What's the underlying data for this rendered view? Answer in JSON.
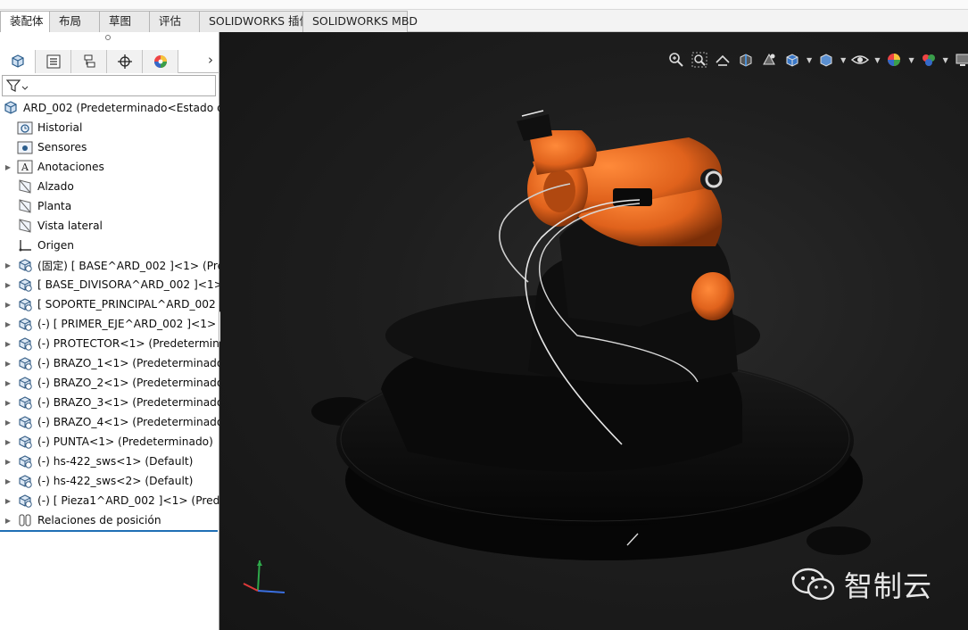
{
  "tabs": [
    {
      "label": "装配体",
      "active": true
    },
    {
      "label": "布局"
    },
    {
      "label": "草图"
    },
    {
      "label": "评估"
    },
    {
      "label": "SOLIDWORKS 插件"
    },
    {
      "label": "SOLIDWORKS MBD"
    }
  ],
  "tree": {
    "root": "ARD_002  (Predeterminado<Estado d",
    "items": [
      {
        "label": "Historial",
        "icon": "history-folder-icon",
        "expandable": false
      },
      {
        "label": "Sensores",
        "icon": "sensor-folder-icon",
        "expandable": false
      },
      {
        "label": "Anotaciones",
        "icon": "annotations-icon",
        "expandable": true
      },
      {
        "label": "Alzado",
        "icon": "plane-icon",
        "expandable": false
      },
      {
        "label": "Planta",
        "icon": "plane-icon",
        "expandable": false
      },
      {
        "label": "Vista lateral",
        "icon": "plane-icon",
        "expandable": false
      },
      {
        "label": "Origen",
        "icon": "origin-icon",
        "expandable": false
      },
      {
        "label": "(固定) [ BASE^ARD_002 ]<1> (Pre",
        "icon": "part-icon",
        "expandable": true
      },
      {
        "label": "[ BASE_DIVISORA^ARD_002 ]<1>",
        "icon": "part-icon",
        "expandable": true
      },
      {
        "label": "[ SOPORTE_PRINCIPAL^ARD_002 ]",
        "icon": "part-icon",
        "expandable": true
      },
      {
        "label": "(-) [ PRIMER_EJE^ARD_002 ]<1> (",
        "icon": "part-icon",
        "expandable": true
      },
      {
        "label": "(-) PROTECTOR<1> (Predetermina",
        "icon": "part-icon",
        "expandable": true
      },
      {
        "label": "(-) BRAZO_1<1> (Predeterminado",
        "icon": "part-icon",
        "expandable": true
      },
      {
        "label": "(-) BRAZO_2<1> (Predeterminado",
        "icon": "part-icon",
        "expandable": true
      },
      {
        "label": "(-) BRAZO_3<1> (Predeterminado",
        "icon": "part-icon",
        "expandable": true
      },
      {
        "label": "(-) BRAZO_4<1> (Predeterminado",
        "icon": "part-icon",
        "expandable": true
      },
      {
        "label": "(-) PUNTA<1> (Predeterminado)",
        "icon": "part-icon",
        "expandable": true
      },
      {
        "label": "(-) hs-422_sws<1> (Default)",
        "icon": "part-icon",
        "expandable": true
      },
      {
        "label": "(-) hs-422_sws<2> (Default)",
        "icon": "part-icon",
        "expandable": true
      },
      {
        "label": "(-) [ Pieza1^ARD_002 ]<1> (Prede",
        "icon": "part-icon",
        "expandable": true
      },
      {
        "label": "Relaciones de posición",
        "icon": "mates-icon",
        "expandable": true
      }
    ]
  },
  "watermark": "智制云",
  "colors": {
    "robot": "#e0621c",
    "base": "#0d0d0d",
    "accent": "#1f6fb5"
  }
}
